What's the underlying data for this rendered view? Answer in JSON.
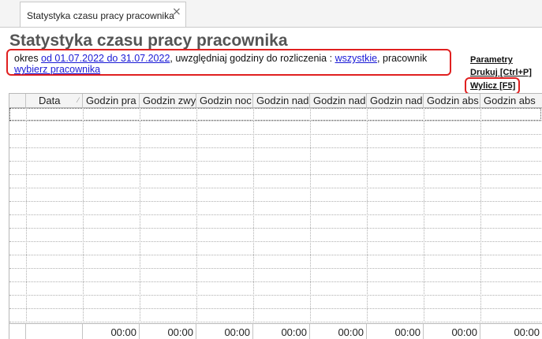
{
  "tab": {
    "label": "Statystyka czasu pracy pracownika",
    "close": "×"
  },
  "title": "Statystyka czasu pracy pracownika",
  "filter": {
    "prefix": "okres ",
    "period_link": "od 01.07.2022 do 31.07.2022",
    "mid": ", uwzględniaj godziny do rozliczenia : ",
    "hours_link": "wszystkie",
    "employee_text": ", pracownik ",
    "employee_link": "wybierz pracownika"
  },
  "actions": {
    "params": "Parametry",
    "print": "Drukuj [Ctrl+P]",
    "calculate": "Wylicz [F5]"
  },
  "grid": {
    "columns": [
      "",
      "Data",
      "Godzin pra",
      "Godzin zwy",
      "Godzin noc",
      "Godzin nadl",
      "Godzin nadl",
      "Godzin nadl",
      "Godzin abs",
      "Godzin abs"
    ],
    "footer": [
      "",
      "",
      "00:00",
      "00:00",
      "00:00",
      "00:00",
      "00:00",
      "00:00",
      "00:00",
      "00:00"
    ]
  },
  "colors": {
    "highlight_border": "#e02020",
    "link": "#1a1ad6"
  }
}
